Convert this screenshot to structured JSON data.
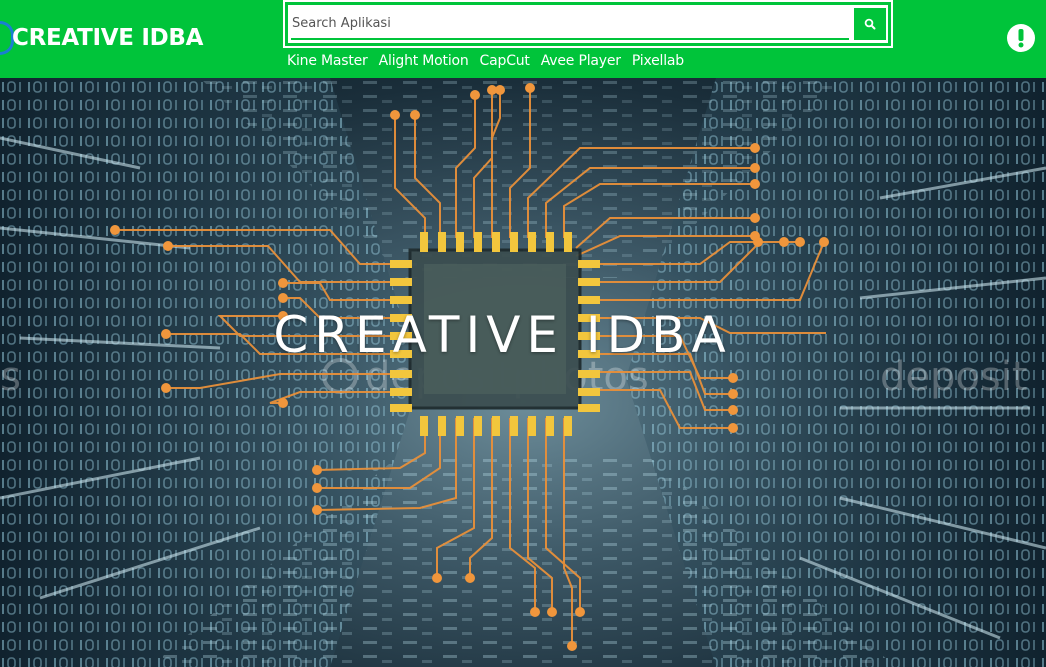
{
  "header": {
    "logo_text": "CREATIVE IDBA",
    "search": {
      "placeholder": "Search Aplikasi",
      "value": ""
    },
    "nav": [
      "Kine Master",
      "Alight Motion",
      "CapCut",
      "Avee Player",
      "Pixellab"
    ]
  },
  "hero": {
    "title": "CREATIVE IDBA"
  },
  "colors": {
    "brand_green": "#00c43a",
    "circuit_orange": "#f0963c",
    "pin_yellow": "#f5c842"
  },
  "icons": {
    "search_button": "search-icon",
    "alert_button": "exclamation-circle-icon"
  }
}
